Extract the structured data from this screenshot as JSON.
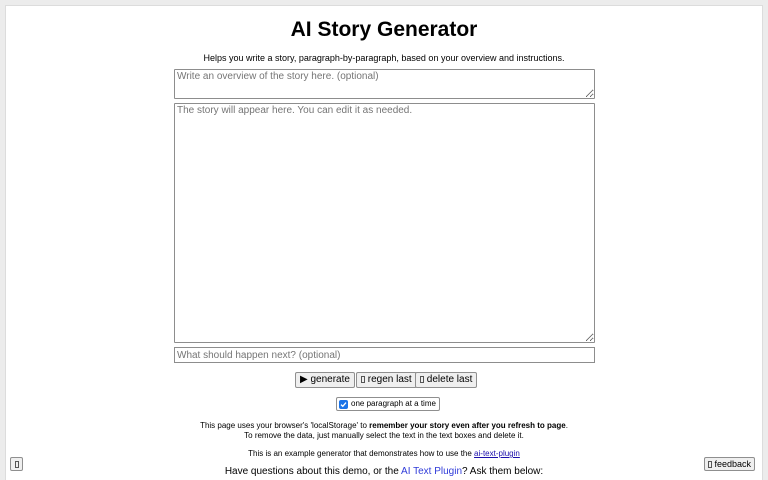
{
  "header": {
    "title": "AI Story Generator",
    "subtitle": "Helps you write a story, paragraph-by-paragraph, based on your overview and instructions."
  },
  "inputs": {
    "overview_placeholder": "Write an overview of the story here. (optional)",
    "story_placeholder": "The story will appear here. You can edit it as needed.",
    "next_placeholder": "What should happen next? (optional)"
  },
  "buttons": {
    "generate": "▶ generate",
    "regen_last": "regen last",
    "delete_last": "delete last"
  },
  "toggle": {
    "label": "one paragraph at a time",
    "checked": true
  },
  "info": {
    "storage_prefix": "This page uses your browser's 'localStorage' to ",
    "storage_bold": "remember your story even after you refresh to page",
    "storage_suffix": ".",
    "remove_text": "To remove the data, just manually select the text in the text boxes and delete it.",
    "example_prefix": "This is an example generator that demonstrates how to use the ",
    "example_link": "ai-text-plugin",
    "questions_prefix": "Have questions about this demo, or the ",
    "questions_link": "AI Text Plugin",
    "questions_suffix": "? Ask them below:"
  },
  "corner": {
    "feedback": "feedback"
  },
  "colors": {
    "accent": "#1a73e8",
    "link": "#2f3bd9",
    "background": "#ececec"
  },
  "icons": {
    "generate": "play-icon",
    "regen": "redo-icon",
    "delete": "trash-icon",
    "menu": "menu-icon",
    "feedback": "feedback-icon"
  }
}
